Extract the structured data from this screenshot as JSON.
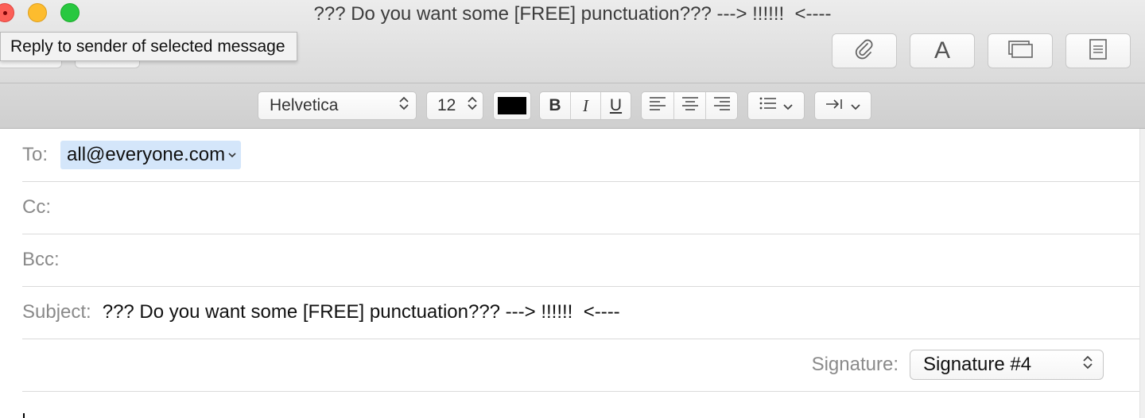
{
  "window": {
    "title": "??? Do you want some [FREE] punctuation??? ---> !!!!!!  <----"
  },
  "tooltip": {
    "text": "Reply to sender of selected message"
  },
  "toolbar": {
    "buttons": [
      {
        "name": "attach",
        "icon": "paperclip-icon"
      },
      {
        "name": "fonts",
        "icon": "font-icon",
        "glyph": "A"
      },
      {
        "name": "browser",
        "icon": "photo-browser-icon"
      },
      {
        "name": "stationery",
        "icon": "stationery-icon"
      }
    ]
  },
  "format": {
    "font": "Helvetica",
    "size": "12",
    "text_color": "#000000",
    "bold": "B",
    "italic": "I",
    "underline": "U"
  },
  "header": {
    "to_label": "To:",
    "to_value": "all@everyone.com",
    "cc_label": "Cc:",
    "bcc_label": "Bcc:",
    "subject_label": "Subject:",
    "subject_value": "??? Do you want some [FREE] punctuation??? ---> !!!!!!  <----",
    "signature_label": "Signature:",
    "signature_value": "Signature #4"
  },
  "colors": {
    "close": "#fc5f57",
    "minimize": "#fdbc2e",
    "zoom": "#28c840",
    "token_bg": "#d4e6fa"
  }
}
